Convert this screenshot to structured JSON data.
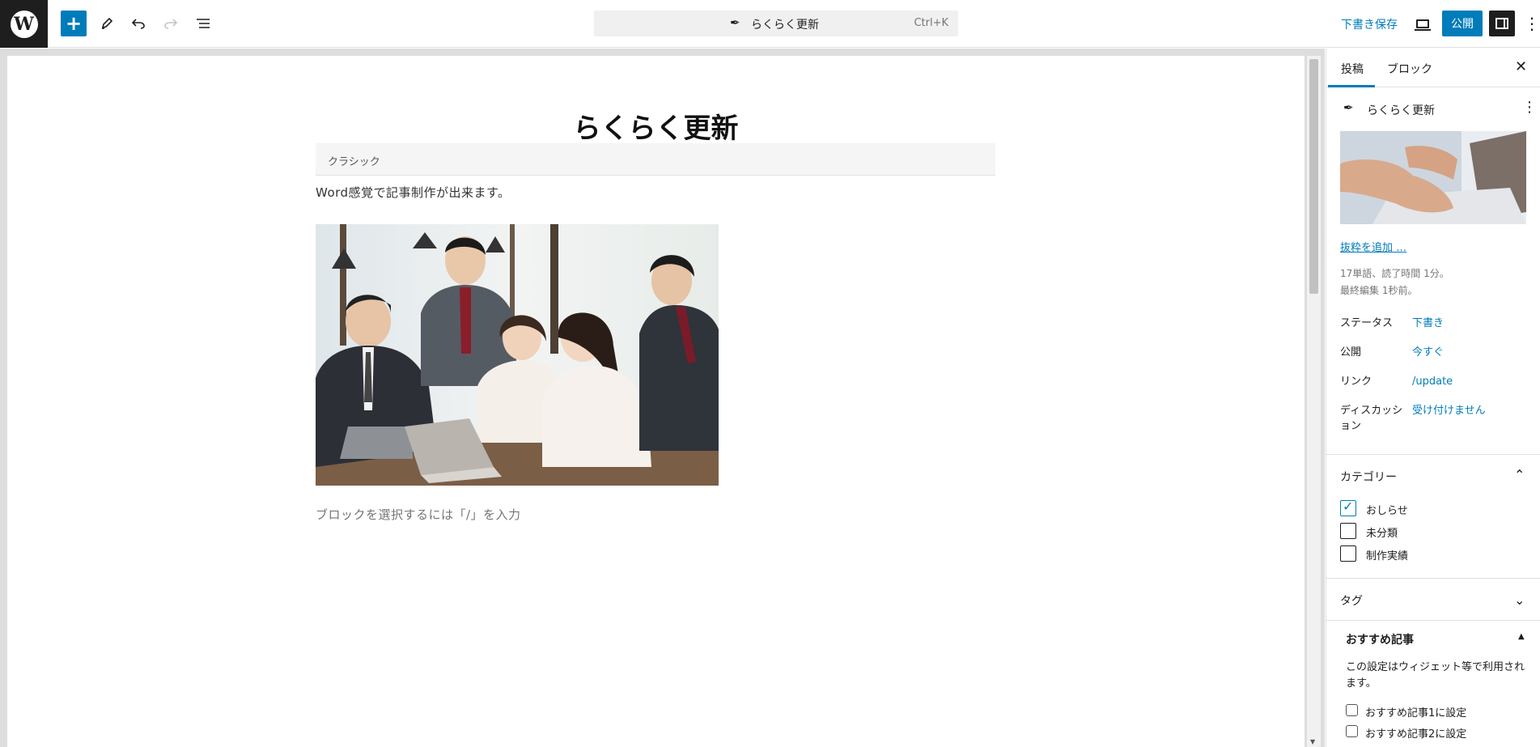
{
  "topbar": {
    "logo_letter": "W",
    "document_title": "らくらく更新",
    "shortcut": "Ctrl+K",
    "save_draft": "下書き保存",
    "publish": "公開"
  },
  "editor": {
    "post_title": "らくらく更新",
    "classic_block_label": "クラシック",
    "paragraph": "Word感覚で記事制作が出来ます。",
    "placeholder": "ブロックを選択するには「/」を入力"
  },
  "sidebar": {
    "tabs": [
      {
        "label": "投稿",
        "active": true
      },
      {
        "label": "ブロック",
        "active": false
      }
    ],
    "post_name": "らくらく更新",
    "add_excerpt": "抜粋を追加 …",
    "word_count": "17単語、読了時間 1分。",
    "last_edited": "最終編集 1秒前。",
    "rows": [
      {
        "label": "ステータス",
        "value": "下書き"
      },
      {
        "label": "公開",
        "value": "今すぐ"
      },
      {
        "label": "リンク",
        "value": "/update"
      },
      {
        "label": "ディスカッション",
        "value": "受け付けません"
      }
    ],
    "categories_title": "カテゴリー",
    "categories": [
      {
        "label": "おしらせ",
        "checked": true
      },
      {
        "label": "未分類",
        "checked": false
      },
      {
        "label": "制作実績",
        "checked": false
      }
    ],
    "tags_title": "タグ",
    "recommended_title": "おすすめ記事",
    "recommended_desc": "この設定はウィジェット等で利用されます。",
    "recommended_options": [
      {
        "label": "おすすめ記事1に設定",
        "checked": false
      },
      {
        "label": "おすすめ記事2に設定",
        "checked": false
      }
    ]
  },
  "colors": {
    "accent": "#007cba",
    "dark": "#1e1e1e"
  }
}
